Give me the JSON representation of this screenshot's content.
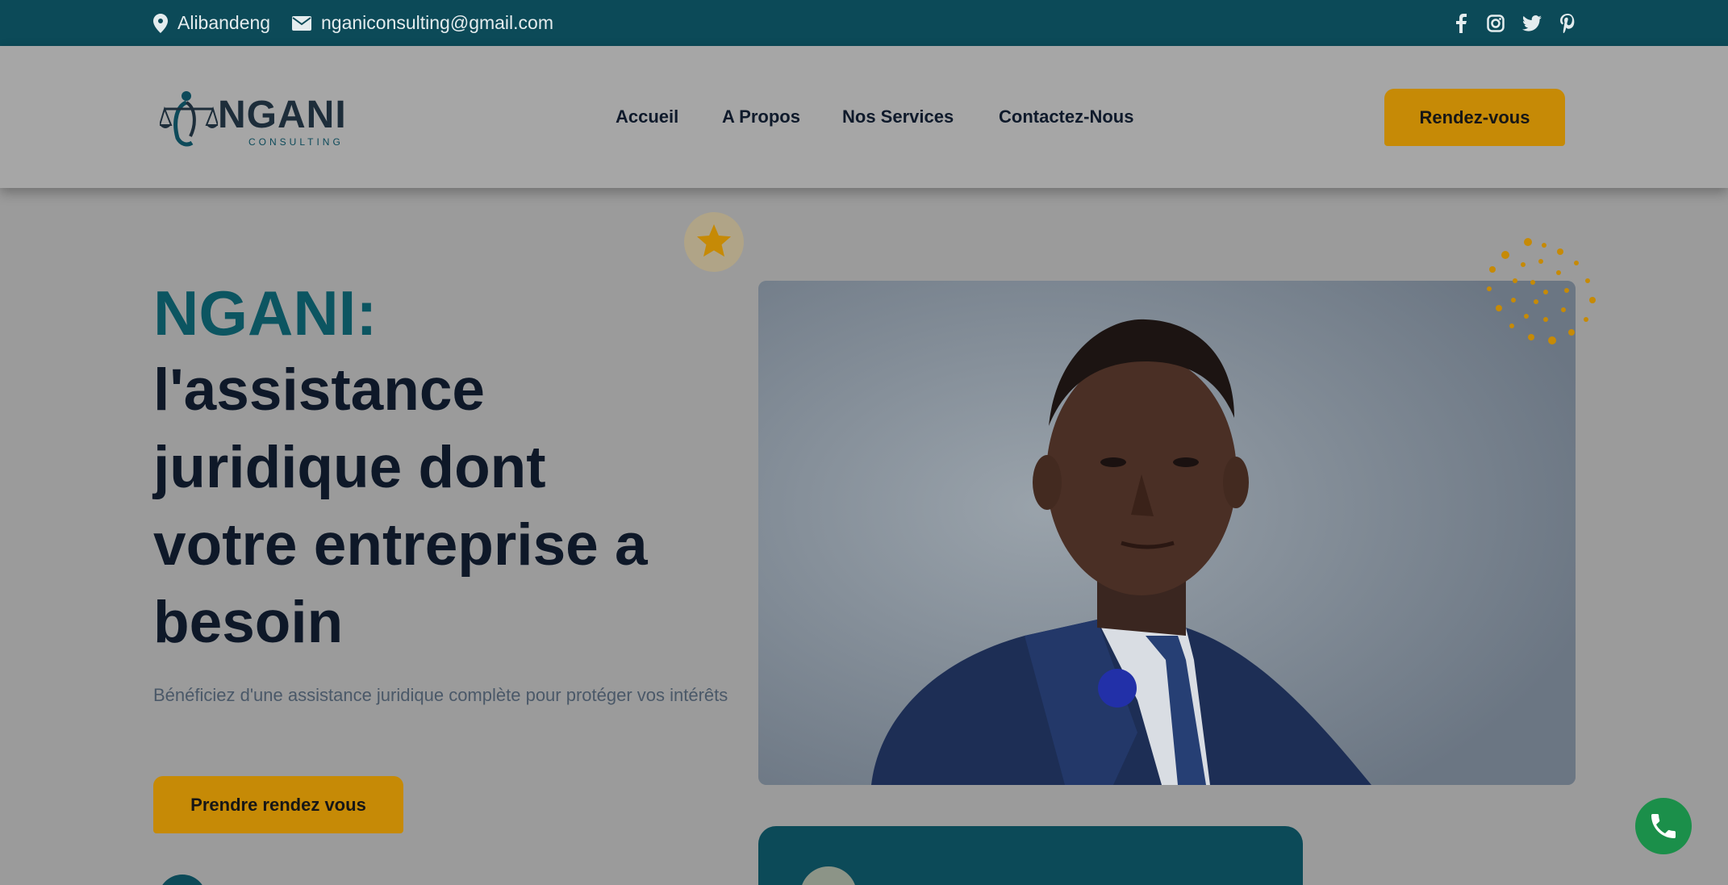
{
  "topbar": {
    "location": "Alibandeng",
    "email": "nganiconsulting@gmail.com",
    "socials": [
      "facebook-icon",
      "instagram-icon",
      "twitter-icon",
      "pinterest-icon"
    ]
  },
  "header": {
    "logo_text": "NGANI",
    "logo_sub": "CONSULTING",
    "nav": [
      "Accueil",
      "A Propos",
      "Nos Services",
      "Contactez-Nous"
    ],
    "cta": "Rendez-vous"
  },
  "hero": {
    "kicker": "NGANI:",
    "title_lines": [
      "l'assistance",
      "juridique dont",
      "votre entreprise a",
      "besoin"
    ],
    "subtitle": "Bénéficiez d'une assistance juridique complète pour protéger vos intérêts",
    "cta": "Prendre rendez vous"
  },
  "colors": {
    "teal": "#0c4a58",
    "gold": "#c68a06",
    "navy": "#0e1828",
    "whatsapp": "#1b8f4a"
  }
}
